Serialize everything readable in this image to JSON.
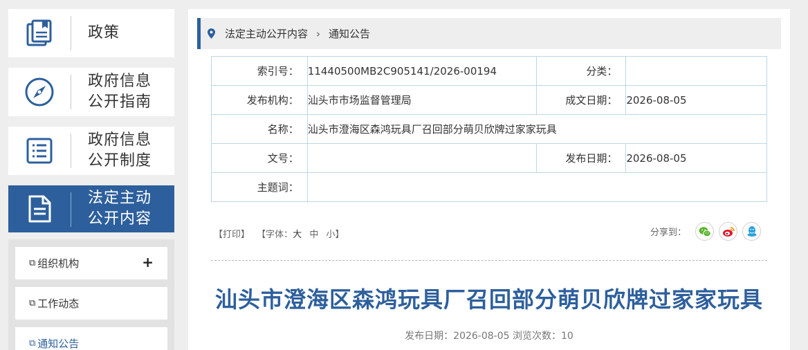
{
  "sidebar": {
    "cards": [
      {
        "label": "政策",
        "icon": "policy-book-icon"
      },
      {
        "label": "政府信息\n公开指南",
        "icon": "compass-icon"
      },
      {
        "label": "政府信息\n公开制度",
        "icon": "list-document-icon"
      },
      {
        "label": "法定主动\n公开内容",
        "icon": "document-icon"
      }
    ],
    "sub_items": [
      {
        "label": "组织机构",
        "expand": "+"
      },
      {
        "label": "工作动态"
      },
      {
        "label": "通知公告"
      }
    ],
    "doc_glyph": "⧉"
  },
  "breadcrumb": {
    "items": [
      "法定主动公开内容",
      "通知公告"
    ],
    "separator": "›",
    "icon": "location-pin-icon"
  },
  "info_table": {
    "index_label": "索引号：",
    "index_value": "11440500MB2C905141/2026-00194",
    "category_label": "分类：",
    "category_value": "",
    "publisher_label": "发布机构：",
    "publisher_value": "汕头市市场监督管理局",
    "written_date_label": "成文日期：",
    "written_date_value": "2026-08-05",
    "name_label": "名称：",
    "name_value": "汕头市澄海区森鸿玩具厂召回部分萌贝欣牌过家家玩具",
    "doc_no_label": "文号：",
    "doc_no_value": "",
    "publish_date_label": "发布日期：",
    "publish_date_value": "2026-08-05",
    "keywords_label": "主题词：",
    "keywords_value": ""
  },
  "toolbar": {
    "print": "【打印】",
    "font_prefix": "【字体：",
    "font_large": "大",
    "font_medium": "中",
    "font_small": "小",
    "font_suffix": "】",
    "share_label": "分享到："
  },
  "colors": {
    "brand_blue": "#2d5f9c",
    "wechat": "#5cb531",
    "weibo": "#e6162d",
    "qq": "#2aa2e0"
  },
  "article": {
    "title": "汕头市澄海区森鸿玩具厂召回部分萌贝欣牌过家家玩具",
    "meta": "发布日期：2026-08-05  浏览次数：10"
  }
}
